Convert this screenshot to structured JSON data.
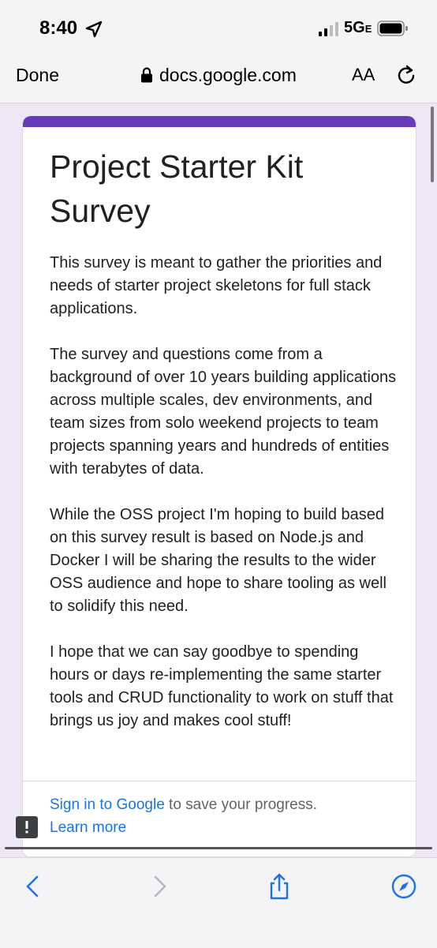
{
  "status_bar": {
    "time": "8:40",
    "network": "5G",
    "network_suffix": "E"
  },
  "browser": {
    "done_label": "Done",
    "url": "docs.google.com",
    "text_size_label": "AA"
  },
  "form": {
    "accent_color": "#673ab7",
    "title": "Project Starter Kit Survey",
    "description": [
      "This survey is meant to gather the priorities and needs of starter project skeletons for full stack applications.",
      "The survey and questions come from a background of over 10 years building applications across multiple scales, dev environments, and team sizes from solo weekend projects to team projects spanning years and hundreds of entities with terabytes of data.",
      "While the OSS project I'm hoping to build based on this survey result is based on Node.js and Docker I will be sharing the results to the wider OSS audience and hope to share tooling as well to solidify this need.",
      "I hope that we can say goodbye to spending hours or days re-implementing the same starter tools and CRUD functionality to work on stuff that brings us joy and makes cool stuff!"
    ],
    "signin_link": "Sign in to Google",
    "signin_suffix": " to save your progress.",
    "learn_more": "Learn more"
  },
  "toolbar": {
    "icons": [
      "back-icon",
      "forward-icon",
      "share-icon",
      "compass-icon"
    ]
  }
}
